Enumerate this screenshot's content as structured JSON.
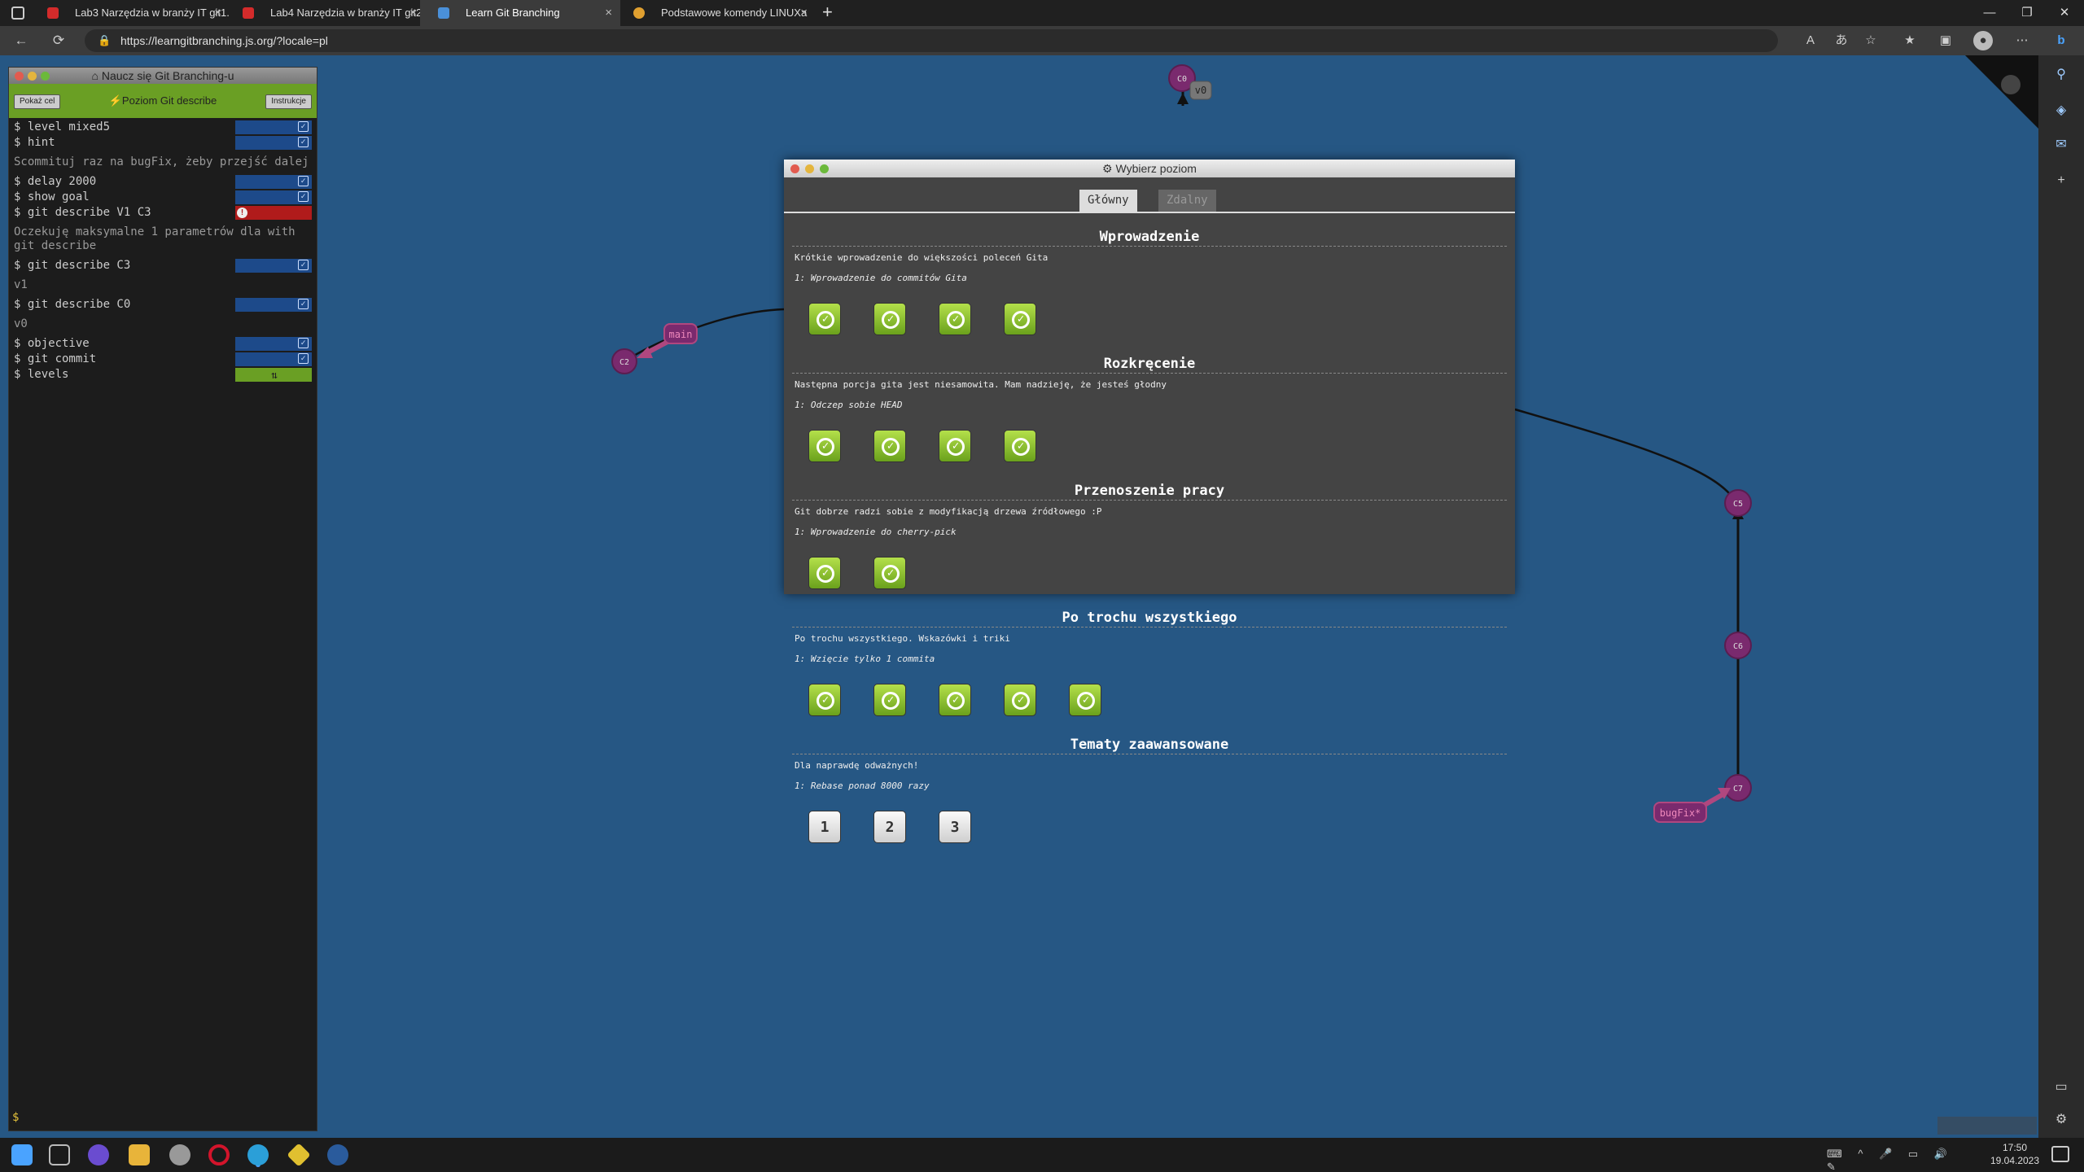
{
  "browser": {
    "tabs": [
      {
        "label": "Lab3 Narzędzia w branży IT git1...",
        "close": "×"
      },
      {
        "label": "Lab4 Narzędzia w branży IT git2...",
        "close": "×"
      },
      {
        "label": "Learn Git Branching",
        "close": "×"
      },
      {
        "label": "Podstawowe komendy LINUXa",
        "close": "×"
      }
    ],
    "new_tab": "+",
    "url": "https://learngitbranching.js.org/?locale=pl",
    "window_controls": [
      "—",
      "❐",
      "✕"
    ]
  },
  "terminal": {
    "title": "Naucz się Git Branching-u",
    "buttons": {
      "left": "Pokaż cel",
      "center": "Poziom Git describe",
      "right": "Instrukcje"
    },
    "lines": [
      {
        "text": "$ level mixed5",
        "status": "ok"
      },
      {
        "text": "$ hint",
        "status": "ok"
      },
      {
        "text": "Scommituj raz na bugFix, żeby przejść dalej",
        "status": "output"
      },
      {
        "text": "$ delay 2000",
        "status": "ok"
      },
      {
        "text": "$ show goal",
        "status": "ok"
      },
      {
        "text": "$ git describe V1 C3",
        "status": "err"
      },
      {
        "text": "Oczekuję maksymalne 1 parametrów dla with git describe",
        "status": "output"
      },
      {
        "text": "$ git describe C3",
        "status": "ok"
      },
      {
        "text": "v1",
        "status": "output"
      },
      {
        "text": "$ git describe C0",
        "status": "ok"
      },
      {
        "text": "v0",
        "status": "output"
      },
      {
        "text": "$ objective",
        "status": "ok"
      },
      {
        "text": "$ git commit",
        "status": "ok"
      },
      {
        "text": "$ levels",
        "status": "level"
      }
    ],
    "prompt": "$"
  },
  "graph": {
    "commits": [
      "C0",
      "C2",
      "C5",
      "C6",
      "C7"
    ],
    "branches": [
      "main",
      "bugFix*"
    ],
    "tags": [
      "v0"
    ]
  },
  "modal": {
    "title": "Wybierz poziom",
    "tabs": [
      "Główny",
      "Zdalny"
    ],
    "active_tab": "Główny",
    "sections": [
      {
        "title": "Wprowadzenie",
        "description": "Krótkie wprowadzenie do większości poleceń Gita",
        "current": "1: Wprowadzenie do commitów Gita",
        "levels": [
          true,
          true,
          true,
          true
        ]
      },
      {
        "title": "Rozkręcenie",
        "description": "Następna porcja gita jest niesamowita. Mam nadzieję, że jesteś głodny",
        "current": "1: Odczep sobie HEAD",
        "levels": [
          true,
          true,
          true,
          true
        ]
      },
      {
        "title": "Przenoszenie pracy",
        "description": "Git dobrze radzi sobie z modyfikacją drzewa źródłowego :P",
        "current": "1: Wprowadzenie do cherry-pick",
        "levels": [
          true,
          true
        ]
      },
      {
        "title": "Po trochu wszystkiego",
        "description": "Po trochu wszystkiego. Wskazówki i triki",
        "current": "1: Wzięcie tylko 1 commita",
        "levels": [
          true,
          true,
          true,
          true,
          true
        ]
      },
      {
        "title": "Tematy zaawansowane",
        "description": "Dla naprawdę odważnych!",
        "current": "1: Rebase ponad 8000 razy",
        "levels": [
          "1",
          "2",
          "3"
        ]
      }
    ]
  },
  "taskbar": {
    "time": "17:50",
    "date": "19.04.2023"
  },
  "colors": {
    "page_bg": "#265784",
    "terminal_bar": "#6a9f24",
    "commit": "#7a2a6e",
    "done_level": "#8bc53f"
  }
}
